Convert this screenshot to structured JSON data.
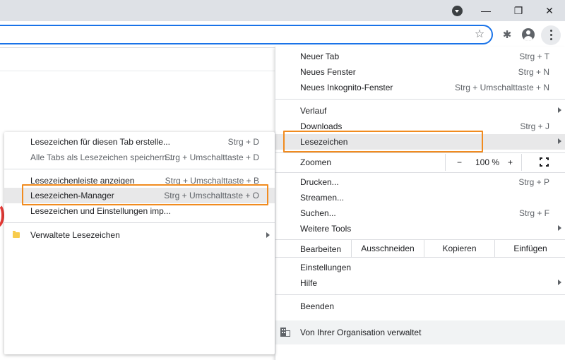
{
  "window": {
    "minimize_glyph": "—",
    "restore_glyph": "❐",
    "close_glyph": "✕"
  },
  "toolbar": {
    "star_glyph": "☆",
    "extensions_glyph": "✱"
  },
  "menu": {
    "items": [
      {
        "label": "Neuer Tab",
        "shortcut": "Strg + T"
      },
      {
        "label": "Neues Fenster",
        "shortcut": "Strg + N"
      },
      {
        "label": "Neues Inkognito-Fenster",
        "shortcut": "Strg + Umschalttaste + N"
      },
      {
        "label": "Verlauf",
        "shortcut": ""
      },
      {
        "label": "Downloads",
        "shortcut": "Strg + J"
      },
      {
        "label": "Lesezeichen",
        "shortcut": ""
      },
      {
        "label": "Drucken...",
        "shortcut": "Strg + P"
      },
      {
        "label": "Streamen...",
        "shortcut": ""
      },
      {
        "label": "Suchen...",
        "shortcut": "Strg + F"
      },
      {
        "label": "Weitere Tools",
        "shortcut": ""
      },
      {
        "label": "Einstellungen",
        "shortcut": ""
      },
      {
        "label": "Hilfe",
        "shortcut": ""
      },
      {
        "label": "Beenden",
        "shortcut": ""
      }
    ],
    "zoom": {
      "label": "Zoomen",
      "minus": "−",
      "value": "100 %",
      "plus": "+"
    },
    "edit": {
      "label": "Bearbeiten",
      "cut": "Ausschneiden",
      "copy": "Kopieren",
      "paste": "Einfügen"
    },
    "managed": "Von Ihrer Organisation verwaltet"
  },
  "bookmarks_submenu": {
    "items": [
      {
        "label": "Lesezeichen für diesen Tab erstelle...",
        "shortcut": "Strg + D"
      },
      {
        "label": "Alle Tabs als Lesezeichen speichern...",
        "shortcut": "Strg + Umschalttaste + D"
      },
      {
        "label": "Lesezeichenleiste anzeigen",
        "shortcut": "Strg + Umschalttaste + B"
      },
      {
        "label": "Lesezeichen-Manager",
        "shortcut": "Strg + Umschalttaste + O"
      },
      {
        "label": "Lesezeichen und Einstellungen imp...",
        "shortcut": ""
      },
      {
        "label": "Verwaltete Lesezeichen",
        "shortcut": ""
      }
    ]
  },
  "colors": {
    "highlight_border": "#f18b1f",
    "omnibox_border": "#1a73e8",
    "folder": "#f7cb4d"
  }
}
